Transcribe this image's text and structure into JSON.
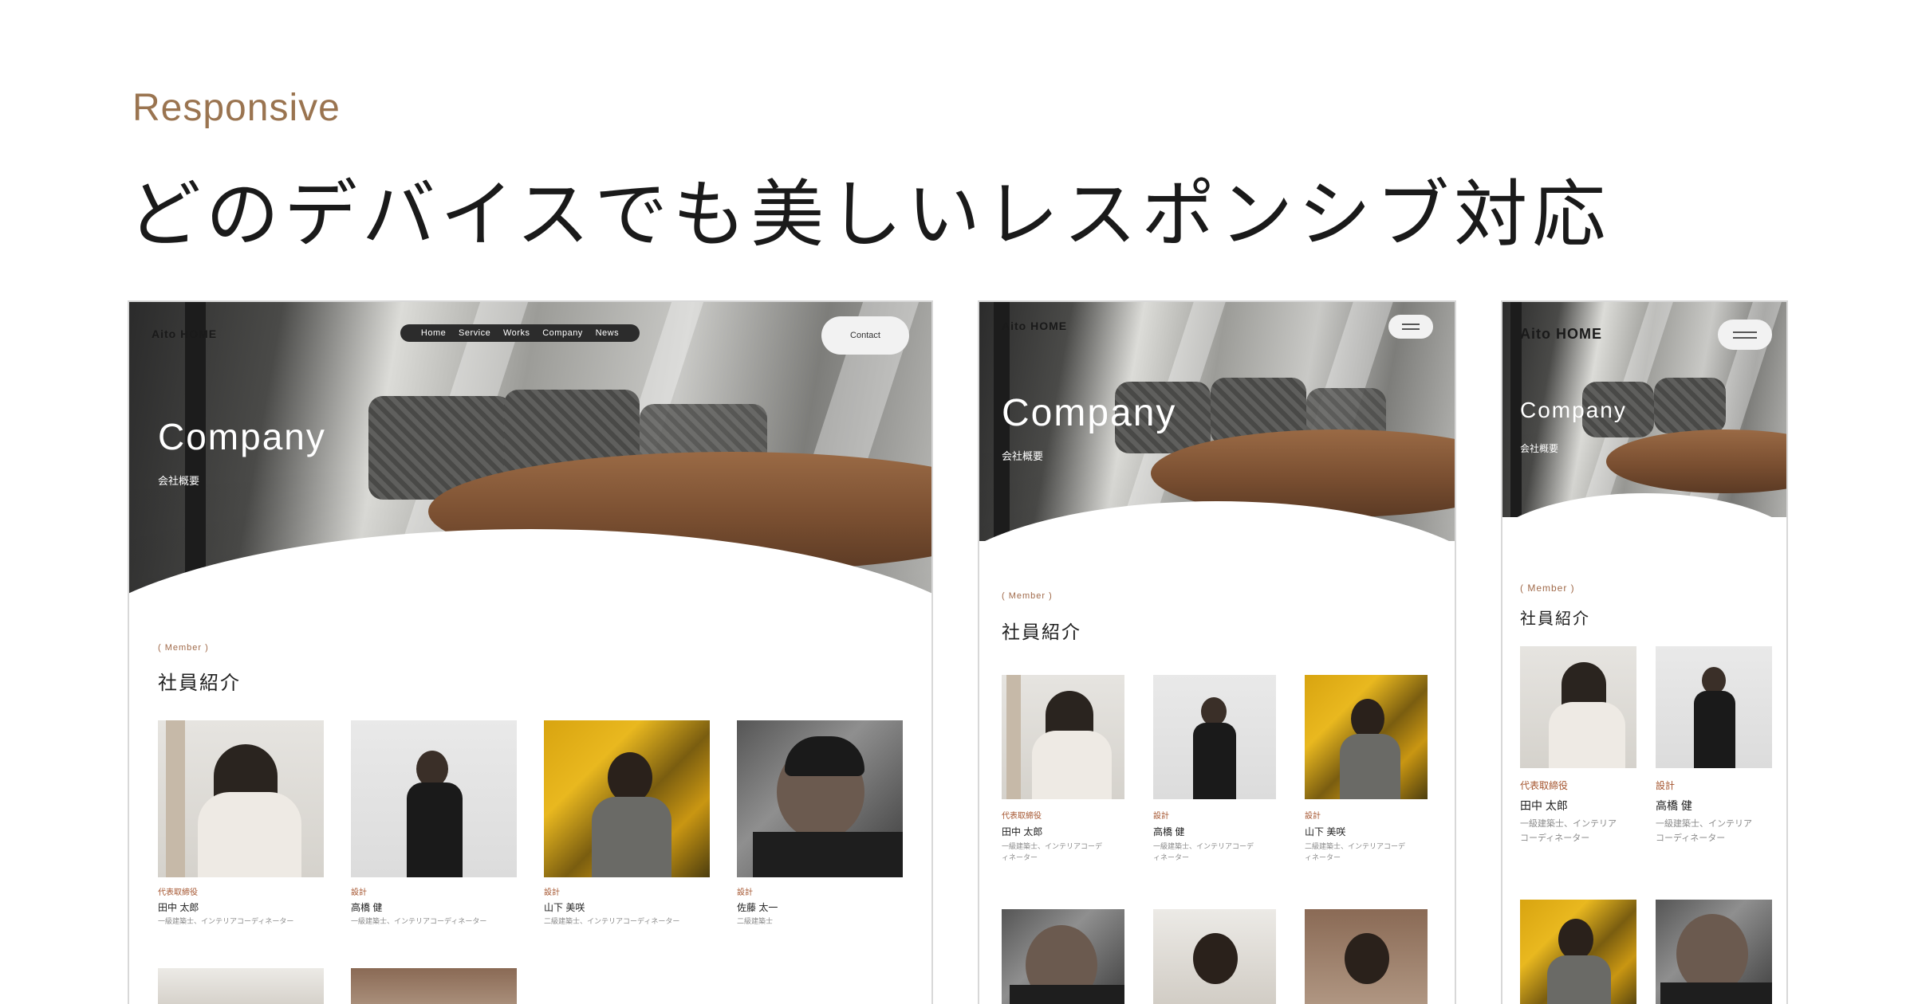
{
  "heading": {
    "eyebrow": "Responsive",
    "title": "どのデバイスでも美しいレスポンシブ対応"
  },
  "site": {
    "logo": "Aito HOME",
    "nav": [
      "Home",
      "Service",
      "Works",
      "Company",
      "News"
    ],
    "contact_label": "Contact",
    "hero_title": "Company",
    "hero_subtitle": "会社概要",
    "section_label": "( Member )",
    "section_title": "社員紹介"
  },
  "members": [
    {
      "role": "代表取締役",
      "name": "田中 太郎",
      "desc": "一級建築士、インテリアコーディネーター"
    },
    {
      "role": "設計",
      "name": "高橋 健",
      "desc": "一級建築士、インテリアコーディネーター"
    },
    {
      "role": "設計",
      "name": "山下 美咲",
      "desc": "二級建築士、インテリアコーディネーター"
    },
    {
      "role": "設計",
      "name": "佐藤 太一",
      "desc": "二級建築士"
    }
  ],
  "members_tablet": [
    {
      "role": "代表取締役",
      "name": "田中 太郎",
      "desc_l1": "一級建築士、インテリアコーデ",
      "desc_l2": "ィネーター"
    },
    {
      "role": "設計",
      "name": "高橋 健",
      "desc_l1": "一級建築士、インテリアコーデ",
      "desc_l2": "ィネーター"
    },
    {
      "role": "設計",
      "name": "山下 美咲",
      "desc_l1": "二級建築士、インテリアコーデ",
      "desc_l2": "ィネーター"
    }
  ],
  "members_mobile": [
    {
      "role": "代表取締役",
      "name": "田中 太郎",
      "desc_l1": "一級建築士、インテリア",
      "desc_l2": "コーディネーター"
    },
    {
      "role": "設計",
      "name": "高橋 健",
      "desc_l1": "一級建築士、インテリア",
      "desc_l2": "コーディネーター"
    }
  ],
  "colors": {
    "eyebrow": "#9a7450",
    "accent_role": "#a4542e",
    "nav_pill": "#2c2c2c"
  }
}
